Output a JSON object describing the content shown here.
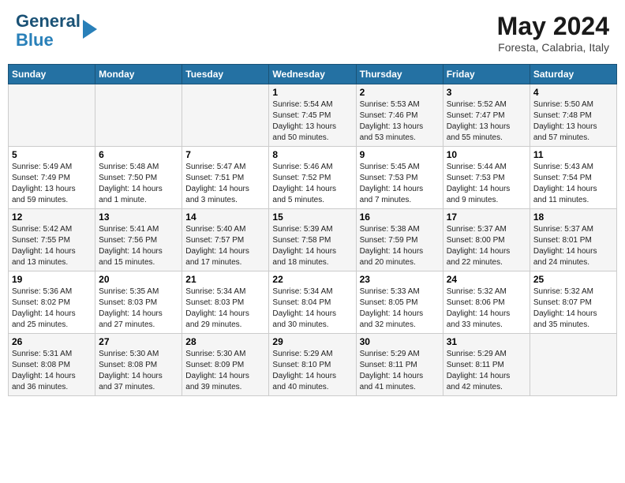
{
  "header": {
    "logo_line1": "General",
    "logo_line2": "Blue",
    "month": "May 2024",
    "location": "Foresta, Calabria, Italy"
  },
  "days_of_week": [
    "Sunday",
    "Monday",
    "Tuesday",
    "Wednesday",
    "Thursday",
    "Friday",
    "Saturday"
  ],
  "weeks": [
    [
      {
        "day": "",
        "info": ""
      },
      {
        "day": "",
        "info": ""
      },
      {
        "day": "",
        "info": ""
      },
      {
        "day": "1",
        "info": "Sunrise: 5:54 AM\nSunset: 7:45 PM\nDaylight: 13 hours\nand 50 minutes."
      },
      {
        "day": "2",
        "info": "Sunrise: 5:53 AM\nSunset: 7:46 PM\nDaylight: 13 hours\nand 53 minutes."
      },
      {
        "day": "3",
        "info": "Sunrise: 5:52 AM\nSunset: 7:47 PM\nDaylight: 13 hours\nand 55 minutes."
      },
      {
        "day": "4",
        "info": "Sunrise: 5:50 AM\nSunset: 7:48 PM\nDaylight: 13 hours\nand 57 minutes."
      }
    ],
    [
      {
        "day": "5",
        "info": "Sunrise: 5:49 AM\nSunset: 7:49 PM\nDaylight: 13 hours\nand 59 minutes."
      },
      {
        "day": "6",
        "info": "Sunrise: 5:48 AM\nSunset: 7:50 PM\nDaylight: 14 hours\nand 1 minute."
      },
      {
        "day": "7",
        "info": "Sunrise: 5:47 AM\nSunset: 7:51 PM\nDaylight: 14 hours\nand 3 minutes."
      },
      {
        "day": "8",
        "info": "Sunrise: 5:46 AM\nSunset: 7:52 PM\nDaylight: 14 hours\nand 5 minutes."
      },
      {
        "day": "9",
        "info": "Sunrise: 5:45 AM\nSunset: 7:53 PM\nDaylight: 14 hours\nand 7 minutes."
      },
      {
        "day": "10",
        "info": "Sunrise: 5:44 AM\nSunset: 7:53 PM\nDaylight: 14 hours\nand 9 minutes."
      },
      {
        "day": "11",
        "info": "Sunrise: 5:43 AM\nSunset: 7:54 PM\nDaylight: 14 hours\nand 11 minutes."
      }
    ],
    [
      {
        "day": "12",
        "info": "Sunrise: 5:42 AM\nSunset: 7:55 PM\nDaylight: 14 hours\nand 13 minutes."
      },
      {
        "day": "13",
        "info": "Sunrise: 5:41 AM\nSunset: 7:56 PM\nDaylight: 14 hours\nand 15 minutes."
      },
      {
        "day": "14",
        "info": "Sunrise: 5:40 AM\nSunset: 7:57 PM\nDaylight: 14 hours\nand 17 minutes."
      },
      {
        "day": "15",
        "info": "Sunrise: 5:39 AM\nSunset: 7:58 PM\nDaylight: 14 hours\nand 18 minutes."
      },
      {
        "day": "16",
        "info": "Sunrise: 5:38 AM\nSunset: 7:59 PM\nDaylight: 14 hours\nand 20 minutes."
      },
      {
        "day": "17",
        "info": "Sunrise: 5:37 AM\nSunset: 8:00 PM\nDaylight: 14 hours\nand 22 minutes."
      },
      {
        "day": "18",
        "info": "Sunrise: 5:37 AM\nSunset: 8:01 PM\nDaylight: 14 hours\nand 24 minutes."
      }
    ],
    [
      {
        "day": "19",
        "info": "Sunrise: 5:36 AM\nSunset: 8:02 PM\nDaylight: 14 hours\nand 25 minutes."
      },
      {
        "day": "20",
        "info": "Sunrise: 5:35 AM\nSunset: 8:03 PM\nDaylight: 14 hours\nand 27 minutes."
      },
      {
        "day": "21",
        "info": "Sunrise: 5:34 AM\nSunset: 8:03 PM\nDaylight: 14 hours\nand 29 minutes."
      },
      {
        "day": "22",
        "info": "Sunrise: 5:34 AM\nSunset: 8:04 PM\nDaylight: 14 hours\nand 30 minutes."
      },
      {
        "day": "23",
        "info": "Sunrise: 5:33 AM\nSunset: 8:05 PM\nDaylight: 14 hours\nand 32 minutes."
      },
      {
        "day": "24",
        "info": "Sunrise: 5:32 AM\nSunset: 8:06 PM\nDaylight: 14 hours\nand 33 minutes."
      },
      {
        "day": "25",
        "info": "Sunrise: 5:32 AM\nSunset: 8:07 PM\nDaylight: 14 hours\nand 35 minutes."
      }
    ],
    [
      {
        "day": "26",
        "info": "Sunrise: 5:31 AM\nSunset: 8:08 PM\nDaylight: 14 hours\nand 36 minutes."
      },
      {
        "day": "27",
        "info": "Sunrise: 5:30 AM\nSunset: 8:08 PM\nDaylight: 14 hours\nand 37 minutes."
      },
      {
        "day": "28",
        "info": "Sunrise: 5:30 AM\nSunset: 8:09 PM\nDaylight: 14 hours\nand 39 minutes."
      },
      {
        "day": "29",
        "info": "Sunrise: 5:29 AM\nSunset: 8:10 PM\nDaylight: 14 hours\nand 40 minutes."
      },
      {
        "day": "30",
        "info": "Sunrise: 5:29 AM\nSunset: 8:11 PM\nDaylight: 14 hours\nand 41 minutes."
      },
      {
        "day": "31",
        "info": "Sunrise: 5:29 AM\nSunset: 8:11 PM\nDaylight: 14 hours\nand 42 minutes."
      },
      {
        "day": "",
        "info": ""
      }
    ]
  ]
}
